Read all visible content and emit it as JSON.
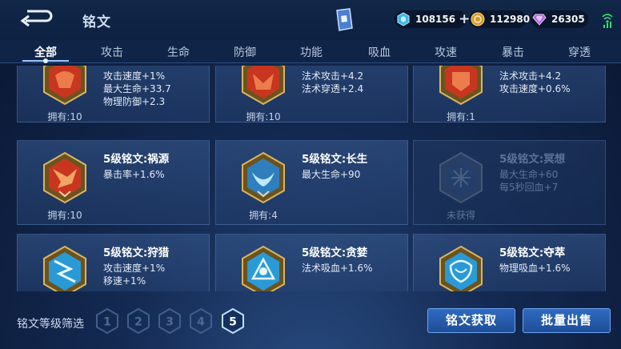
{
  "header": {
    "title": "铭文",
    "currencies": [
      {
        "icon": "diamond-coupon-icon",
        "value": "108156"
      },
      {
        "icon": "gold-coin-icon",
        "value": "112980"
      },
      {
        "icon": "purple-gem-icon",
        "value": "26305"
      }
    ]
  },
  "tabs": [
    "全部",
    "攻击",
    "生命",
    "防御",
    "功能",
    "吸血",
    "攻速",
    "暴击",
    "穿透"
  ],
  "active_tab": "全部",
  "runes": [
    {
      "name": "",
      "attrs": [
        "攻击速度+1%",
        "最大生命+33.7",
        "物理防御+2.3"
      ],
      "owned": "拥有:10",
      "color": "#c8361f",
      "locked": false
    },
    {
      "name": "",
      "attrs": [
        "法术攻击+4.2",
        "法术穿透+2.4"
      ],
      "owned": "拥有:10",
      "color": "#c8361f",
      "locked": false
    },
    {
      "name": "",
      "attrs": [
        "法术攻击+4.2",
        "攻击速度+0.6%"
      ],
      "owned": "拥有:1",
      "color": "#c8361f",
      "locked": false
    },
    {
      "name": "5级铭文:祸源",
      "attrs": [
        "暴击率+1.6%"
      ],
      "owned": "拥有:10",
      "color": "#c8361f",
      "locked": false
    },
    {
      "name": "5级铭文:长生",
      "attrs": [
        "最大生命+90"
      ],
      "owned": "拥有:4",
      "color": "#2f7fbf",
      "locked": false
    },
    {
      "name": "5级铭文:冥想",
      "attrs": [
        "最大生命+60",
        "每5秒回血+7"
      ],
      "owned": "未获得",
      "color": "#3a5c8a",
      "locked": true
    },
    {
      "name": "5级铭文:狩猎",
      "attrs": [
        "攻击速度+1%",
        "移速+1%"
      ],
      "owned": "",
      "color": "#2a9ad6",
      "locked": false
    },
    {
      "name": "5级铭文:贪婪",
      "attrs": [
        "法术吸血+1.6%"
      ],
      "owned": "",
      "color": "#2a9ad6",
      "locked": false
    },
    {
      "name": "5级铭文:夺萃",
      "attrs": [
        "物理吸血+1.6%"
      ],
      "owned": "",
      "color": "#2a9ad6",
      "locked": false
    }
  ],
  "filter": {
    "label": "铭文等级筛选",
    "levels": [
      "1",
      "2",
      "3",
      "4",
      "5"
    ],
    "selected": "5"
  },
  "buttons": {
    "acquire": "铭文获取",
    "bulk_sell": "批量出售"
  }
}
